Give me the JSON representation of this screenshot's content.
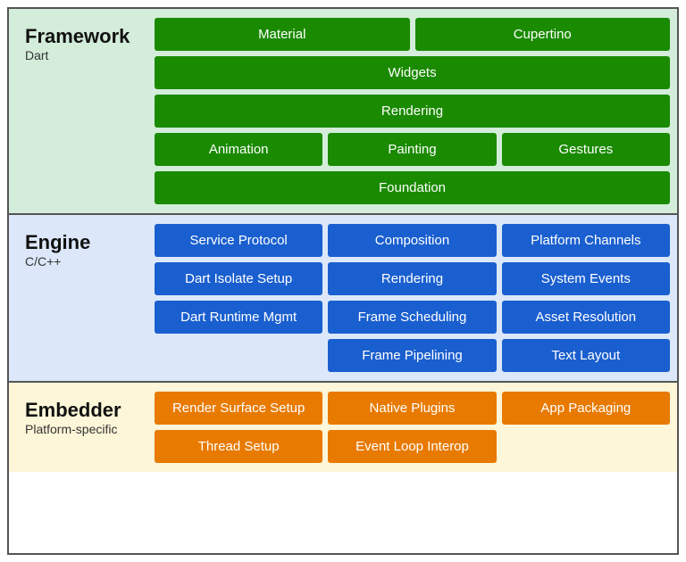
{
  "framework": {
    "title": "Framework",
    "subtitle": "Dart",
    "rows": [
      [
        {
          "label": "Material",
          "flex": 1
        },
        {
          "label": "Cupertino",
          "flex": 1
        }
      ],
      [
        {
          "label": "Widgets",
          "flex": 1
        }
      ],
      [
        {
          "label": "Rendering",
          "flex": 1
        }
      ],
      [
        {
          "label": "Animation",
          "flex": 1
        },
        {
          "label": "Painting",
          "flex": 1
        },
        {
          "label": "Gestures",
          "flex": 1
        }
      ],
      [
        {
          "label": "Foundation",
          "flex": 1
        }
      ]
    ]
  },
  "engine": {
    "title": "Engine",
    "subtitle": "C/C++",
    "rows": [
      [
        {
          "label": "Service Protocol",
          "flex": 1
        },
        {
          "label": "Composition",
          "flex": 1
        },
        {
          "label": "Platform Channels",
          "flex": 1
        }
      ],
      [
        {
          "label": "Dart Isolate Setup",
          "flex": 1
        },
        {
          "label": "Rendering",
          "flex": 1
        },
        {
          "label": "System Events",
          "flex": 1
        }
      ],
      [
        {
          "label": "Dart Runtime Mgmt",
          "flex": 1
        },
        {
          "label": "Frame Scheduling",
          "flex": 1
        },
        {
          "label": "Asset Resolution",
          "flex": 1
        }
      ],
      [
        {
          "label": "",
          "flex": 1,
          "invisible": true
        },
        {
          "label": "Frame Pipelining",
          "flex": 1
        },
        {
          "label": "Text Layout",
          "flex": 1
        }
      ]
    ]
  },
  "embedder": {
    "title": "Embedder",
    "subtitle": "Platform-specific",
    "rows": [
      [
        {
          "label": "Render Surface Setup",
          "flex": 1
        },
        {
          "label": "Native Plugins",
          "flex": 1
        },
        {
          "label": "App Packaging",
          "flex": 1
        }
      ],
      [
        {
          "label": "Thread Setup",
          "flex": 1
        },
        {
          "label": "Event Loop Interop",
          "flex": 1
        },
        {
          "label": "",
          "flex": 1,
          "invisible": true
        }
      ]
    ]
  }
}
